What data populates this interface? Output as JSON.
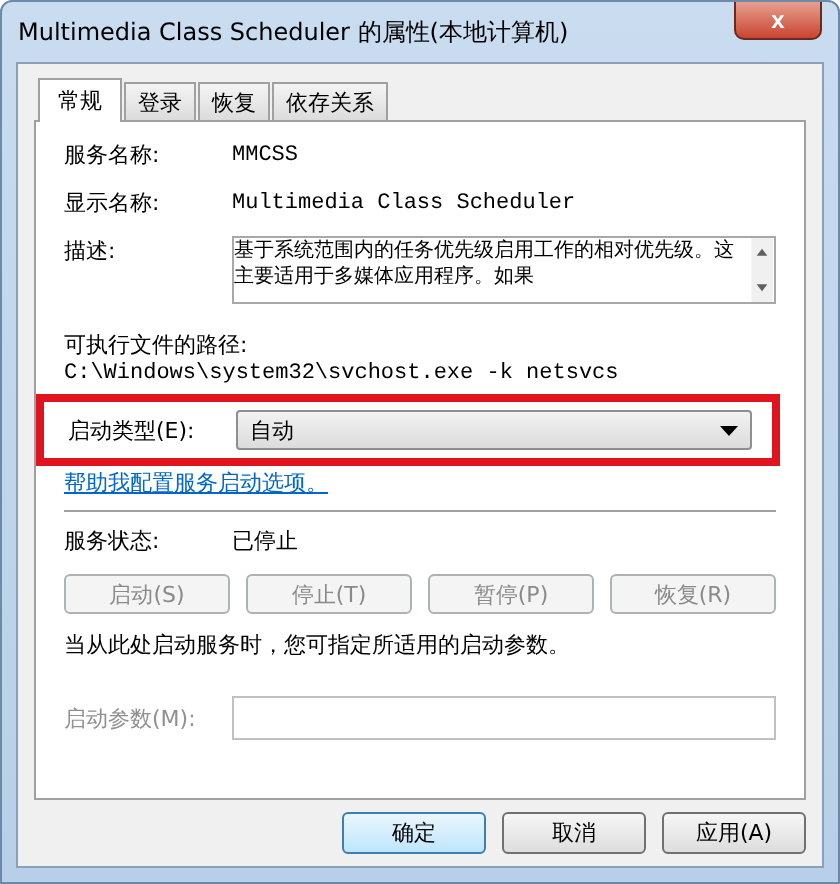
{
  "window": {
    "title": "Multimedia Class Scheduler 的属性(本地计算机)",
    "close": "x"
  },
  "tabs": [
    {
      "label": "常规",
      "selected": true
    },
    {
      "label": "登录",
      "selected": false
    },
    {
      "label": "恢复",
      "selected": false
    },
    {
      "label": "依存关系",
      "selected": false
    }
  ],
  "service_name": {
    "label": "服务名称:",
    "value": "MMCSS"
  },
  "display_name": {
    "label": "显示名称:",
    "value": "Multimedia Class Scheduler"
  },
  "description": {
    "label": "描述:",
    "value": "基于系统范围内的任务优先级启用工作的相对优先级。这主要适用于多媒体应用程序。如果"
  },
  "executable_path": {
    "label": "可执行文件的路径:",
    "value": "C:\\Windows\\system32\\svchost.exe -k netsvcs"
  },
  "startup_type": {
    "label": "启动类型(E):",
    "value": "自动",
    "highlighted": true
  },
  "help_link": "帮助我配置服务启动选项。",
  "service_status": {
    "label": "服务状态:",
    "value": "已停止"
  },
  "service_buttons": [
    {
      "label": "启动(S)",
      "disabled": true
    },
    {
      "label": "停止(T)",
      "disabled": true
    },
    {
      "label": "暂停(P)",
      "disabled": true
    },
    {
      "label": "恢复(R)",
      "disabled": true
    }
  ],
  "hint": "当从此处启动服务时，您可指定所适用的启动参数。",
  "start_parameters": {
    "label": "启动参数(M):",
    "disabled": true
  },
  "buttons": [
    {
      "label": "确定",
      "default": true
    },
    {
      "label": "取消",
      "default": false
    },
    {
      "label": "应用(A)",
      "default": false
    }
  ]
}
